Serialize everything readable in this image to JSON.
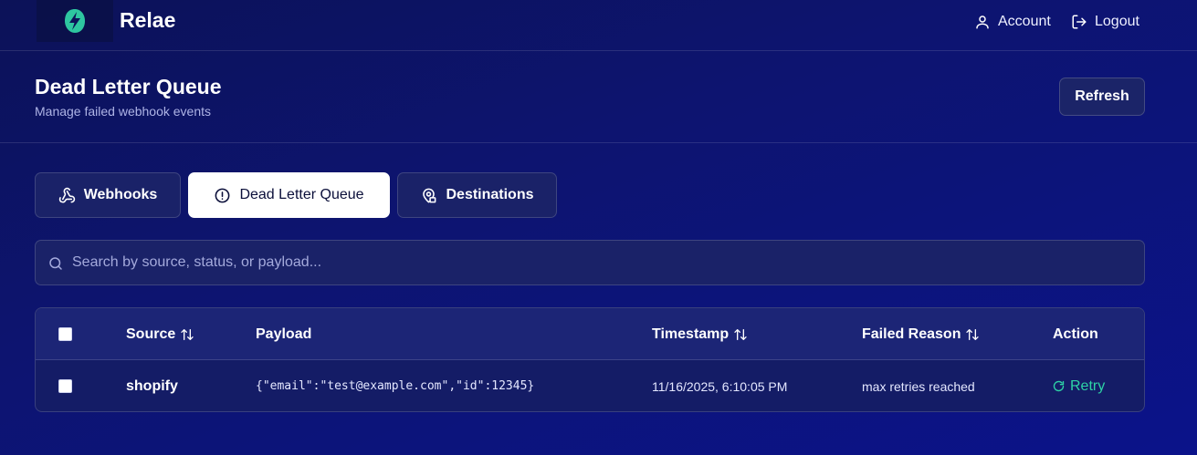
{
  "app": {
    "brand": "Relae"
  },
  "nav": {
    "account_label": "Account",
    "logout_label": "Logout"
  },
  "header": {
    "title": "Dead Letter Queue",
    "subtitle": "Manage failed webhook events",
    "refresh_label": "Refresh"
  },
  "tabs": [
    {
      "label": "Webhooks",
      "icon": "webhook-icon",
      "active": false
    },
    {
      "label": "Dead Letter Queue",
      "icon": "alert-circle-icon",
      "active": true
    },
    {
      "label": "Destinations",
      "icon": "map-pin-icon",
      "active": false
    }
  ],
  "search": {
    "placeholder": "Search by source, status, or payload...",
    "value": ""
  },
  "table": {
    "columns": [
      "Source",
      "Payload",
      "Timestamp",
      "Failed Reason",
      "Action"
    ],
    "rows": [
      {
        "source": "shopify",
        "payload": "{\"email\":\"test@example.com\",\"id\":12345}",
        "timestamp": "11/16/2025, 6:10:05 PM",
        "failed_reason": "max retries reached",
        "action": "Retry"
      }
    ]
  },
  "colors": {
    "background": "#0d1470",
    "panel": "#1a2268",
    "accent_retry": "#2ed3a6",
    "logo": "#2ec6a0"
  }
}
